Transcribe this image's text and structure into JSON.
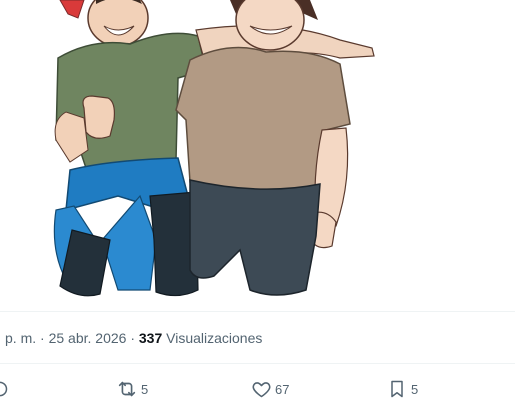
{
  "post": {
    "time_fragment": "p. m.",
    "separator": " · ",
    "date": "25 abr. 2026",
    "views_count": "337",
    "views_label": "Visualizaciones"
  },
  "actions": {
    "reposts": "5",
    "likes": "67",
    "bookmarks": "5"
  },
  "colors": {
    "muted_text": "#536471",
    "primary_text": "#0f1419",
    "divider": "#eff3f4"
  }
}
